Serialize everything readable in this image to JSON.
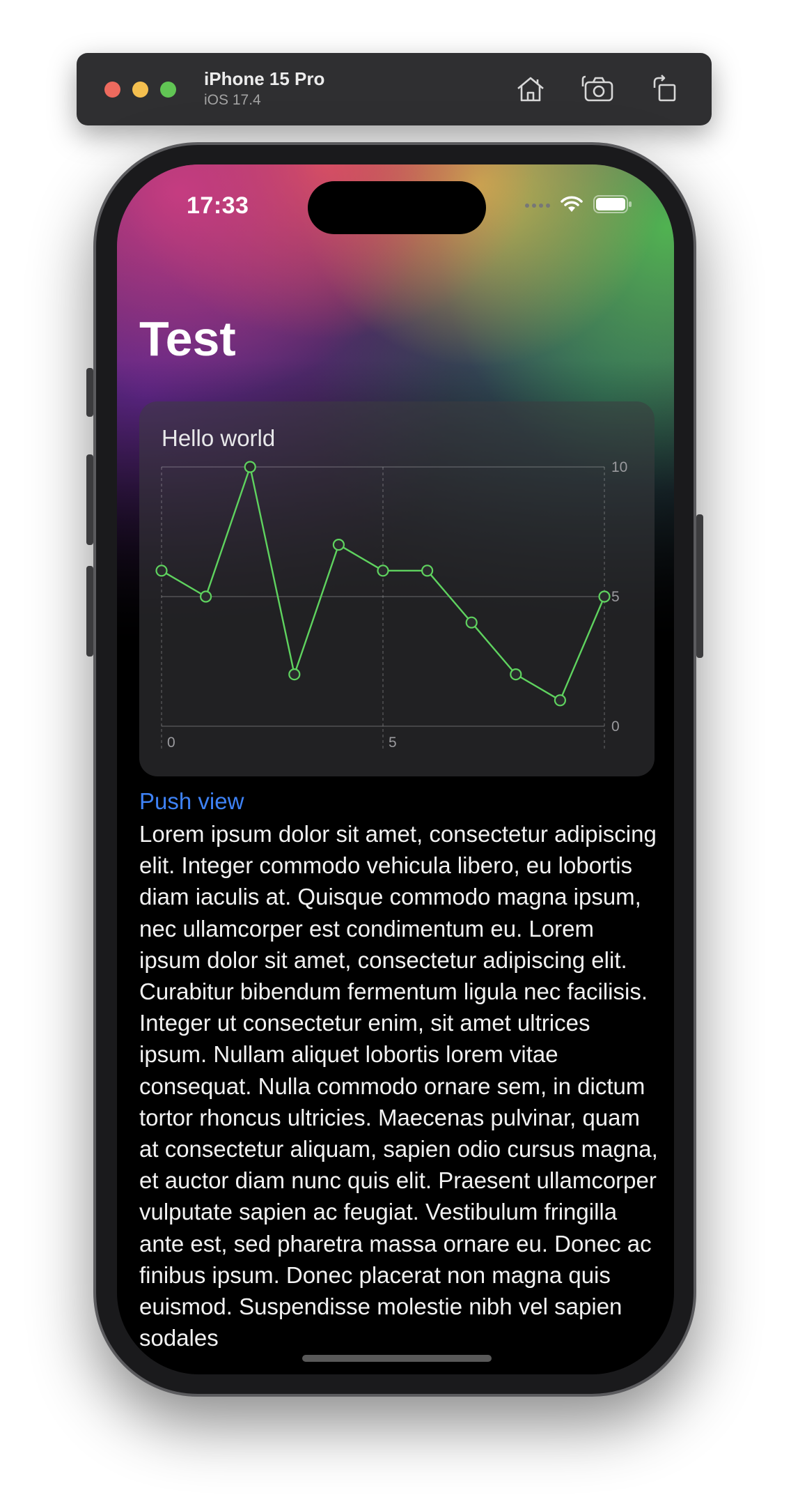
{
  "toolbar": {
    "device_name": "iPhone 15 Pro",
    "os_version": "iOS 17.4",
    "icons": [
      "home-icon",
      "screenshot-icon",
      "rotate-icon"
    ]
  },
  "status_bar": {
    "time": "17:33",
    "icons": [
      "cellular-icon",
      "wifi-icon",
      "battery-icon"
    ]
  },
  "navigation": {
    "title": "Test"
  },
  "card": {
    "title": "Hello world"
  },
  "chart_data": {
    "type": "line",
    "x": [
      0,
      1,
      2,
      3,
      4,
      5,
      6,
      7,
      8,
      9,
      10
    ],
    "values": [
      6,
      5,
      10,
      2,
      7,
      6,
      6,
      4,
      2,
      1,
      5
    ],
    "xlim": [
      0,
      10
    ],
    "ylim": [
      0,
      10
    ],
    "x_ticks": [
      "0",
      "5"
    ],
    "y_ticks": [
      "10",
      "5",
      "0"
    ],
    "color": "#5fd35f",
    "grid": true
  },
  "link": {
    "label": "Push view",
    "color": "#3e82f6"
  },
  "body": {
    "text": "Lorem ipsum dolor sit amet, consectetur adipiscing elit. Integer commodo vehicula libero, eu lobortis diam iaculis at. Quisque commodo magna ipsum, nec ullamcorper est condimentum eu. Lorem ipsum dolor sit amet, consectetur adipiscing elit. Curabitur bibendum fermentum ligula nec facilisis. Integer ut consectetur enim, sit amet ultrices ipsum. Nullam aliquet lobortis lorem vitae consequat. Nulla commodo ornare sem, in dictum tortor rhoncus ultricies. Maecenas pulvinar, quam at consectetur aliquam, sapien odio cursus magna, et auctor diam nunc quis elit. Praesent ullamcorper vulputate sapien ac feugiat. Vestibulum fringilla ante est, sed pharetra massa ornare eu. Donec ac finibus ipsum. Donec placerat non magna quis euismod. Suspendisse molestie nibh vel sapien sodales"
  }
}
